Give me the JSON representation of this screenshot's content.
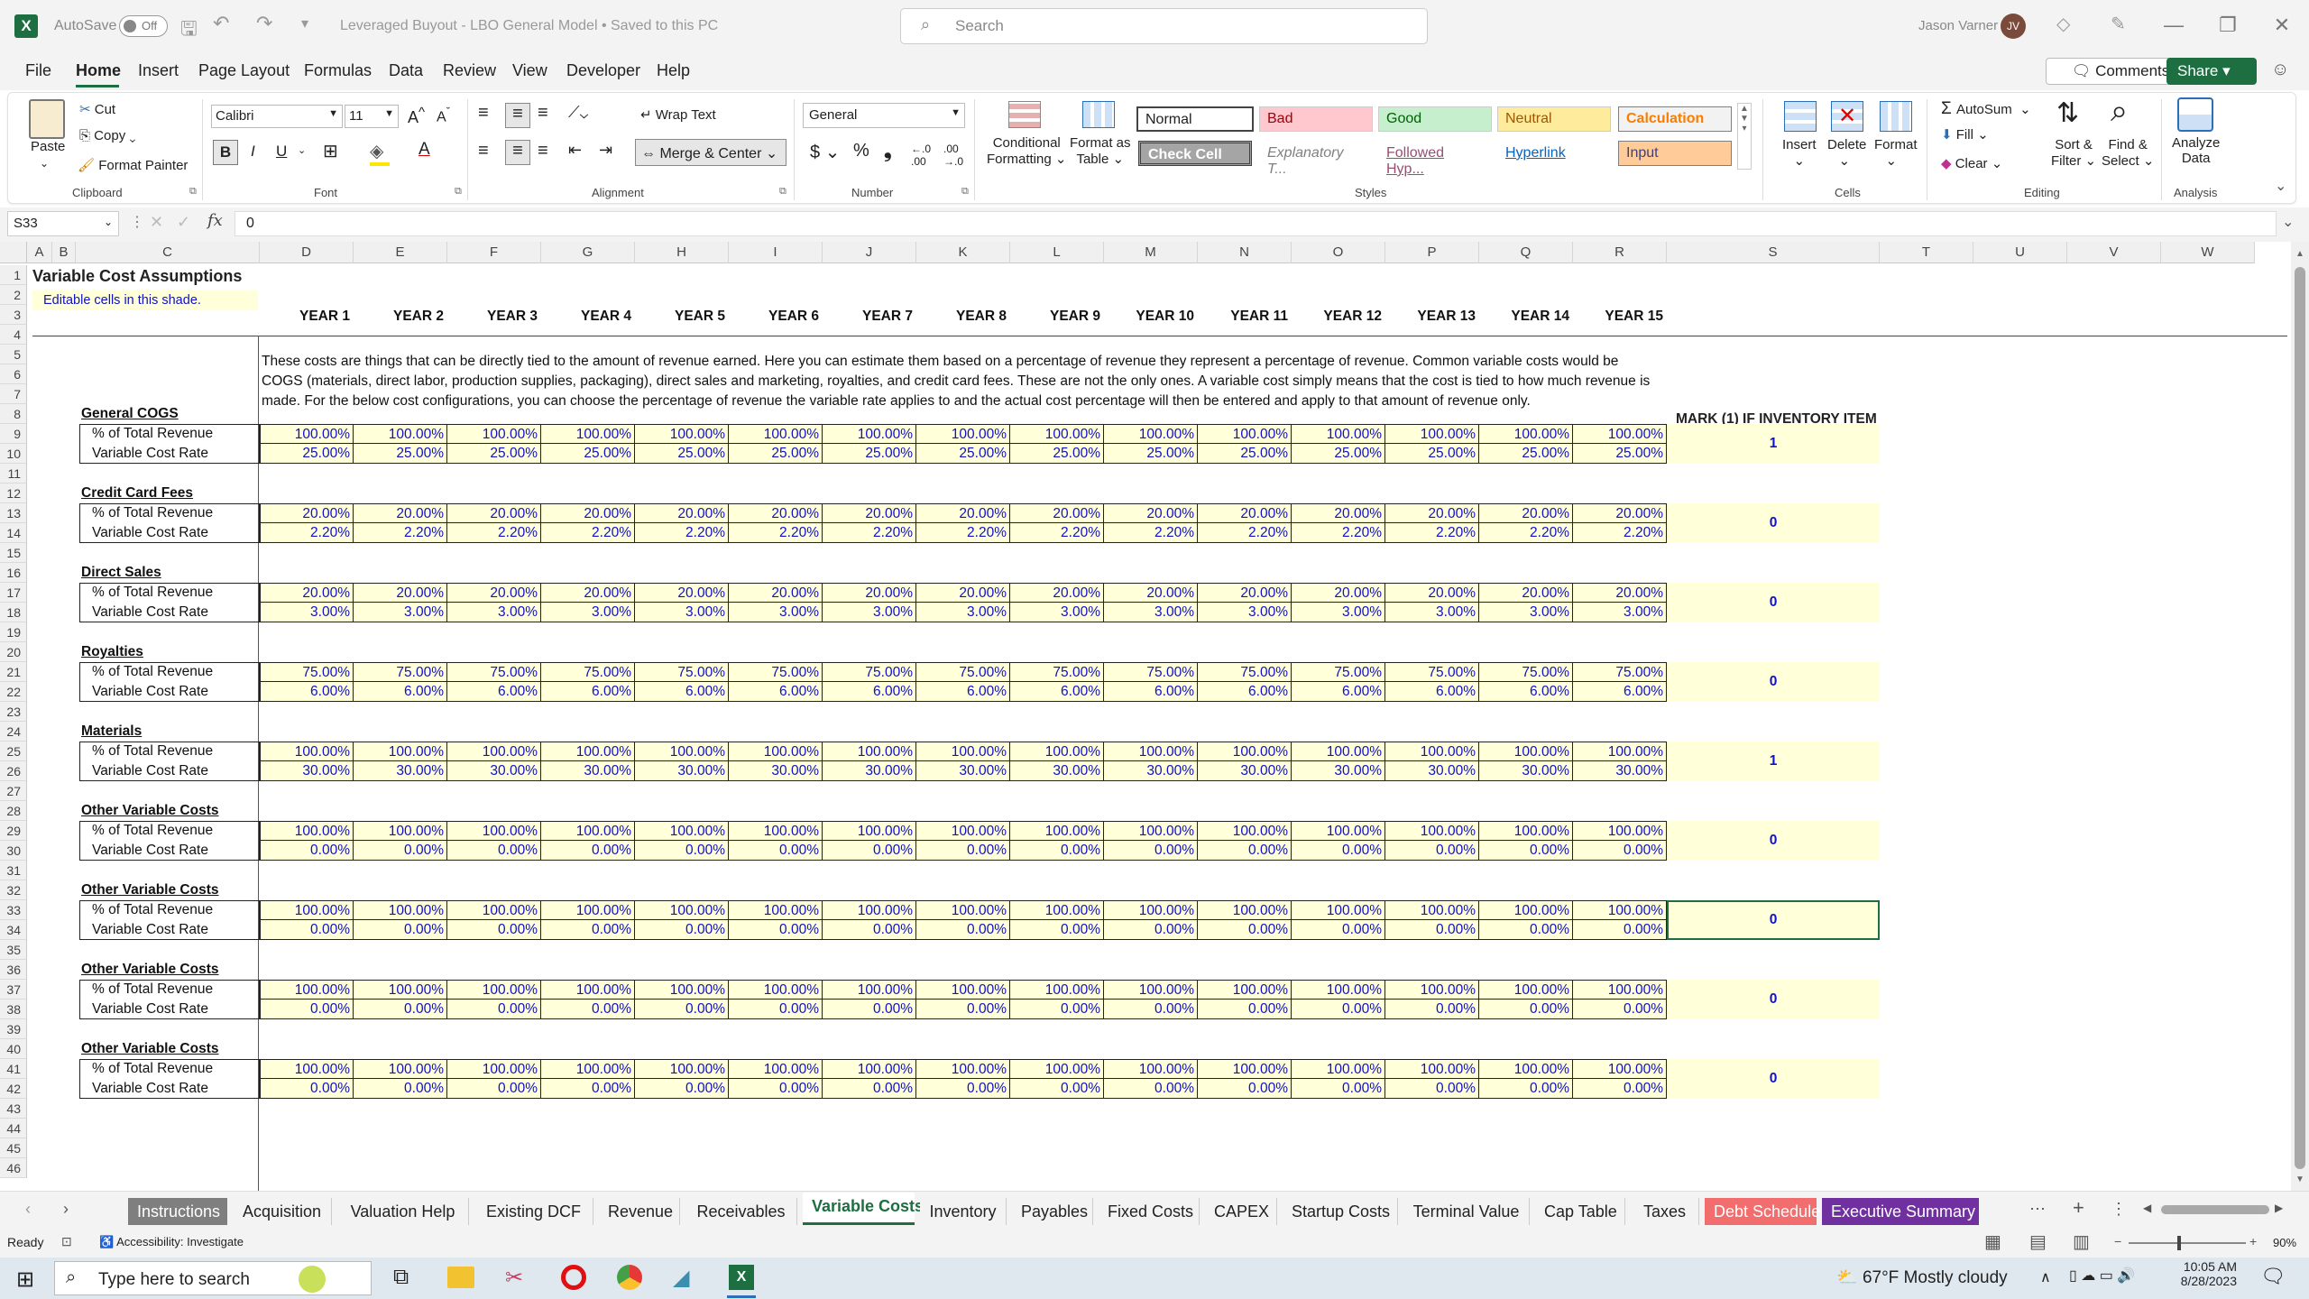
{
  "titlebar": {
    "autosave": "AutoSave",
    "autosave_state": "Off",
    "doc_title": "Leveraged Buyout - LBO General Model • Saved to this PC",
    "search_placeholder": "Search",
    "user_name": "Jason Varner",
    "user_initials": "JV"
  },
  "menu": [
    "File",
    "Home",
    "Insert",
    "Page Layout",
    "Formulas",
    "Data",
    "Review",
    "View",
    "Developer",
    "Help"
  ],
  "menu_right": {
    "comments": "Comments",
    "share": "Share"
  },
  "ribbon": {
    "clipboard": {
      "paste": "Paste",
      "cut": "Cut",
      "copy": "Copy",
      "format_painter": "Format Painter",
      "group": "Clipboard"
    },
    "font": {
      "name": "Calibri",
      "size": "11",
      "group": "Font"
    },
    "alignment": {
      "wrap": "Wrap Text",
      "merge": "Merge & Center",
      "group": "Alignment"
    },
    "number": {
      "format": "General",
      "group": "Number"
    },
    "styles": {
      "conditional": "Conditional",
      "formatting": "Formatting",
      "format_as": "Format as",
      "table": "Table",
      "normal": "Normal",
      "bad": "Bad",
      "good": "Good",
      "neutral": "Neutral",
      "calculation": "Calculation",
      "check_cell": "Check Cell",
      "explanatory": "Explanatory T...",
      "followed": "Followed Hyp...",
      "hyperlink": "Hyperlink",
      "input": "Input",
      "group": "Styles"
    },
    "cells": {
      "insert": "Insert",
      "delete": "Delete",
      "format": "Format",
      "group": "Cells"
    },
    "editing": {
      "autosum": "AutoSum",
      "fill": "Fill",
      "clear": "Clear",
      "sort": "Sort &",
      "filter": "Filter",
      "find": "Find &",
      "select": "Select",
      "group": "Editing"
    },
    "analysis": {
      "analyze": "Analyze",
      "data": "Data",
      "group": "Analysis"
    }
  },
  "formula_bar": {
    "name_box": "S33",
    "fx": "fx",
    "value": "0"
  },
  "columns": [
    "A",
    "B",
    "C",
    "D",
    "E",
    "F",
    "G",
    "H",
    "I",
    "J",
    "K",
    "L",
    "M",
    "N",
    "O",
    "P",
    "Q",
    "R",
    "S",
    "T",
    "U",
    "V",
    "W"
  ],
  "sheet": {
    "title": "Variable Cost Assumptions",
    "subtitle": "Editable cells in this shade.",
    "years": [
      "YEAR 1",
      "YEAR 2",
      "YEAR 3",
      "YEAR 4",
      "YEAR 5",
      "YEAR 6",
      "YEAR 7",
      "YEAR 8",
      "YEAR 9",
      "YEAR 10",
      "YEAR 11",
      "YEAR 12",
      "YEAR 13",
      "YEAR 14",
      "YEAR 15"
    ],
    "description": [
      "These costs are things that can be directly tied to the amount of revenue earned. Here you can estimate them based on a percentage of revenue they represent a percentage of revenue. Common variable costs would be",
      "COGS (materials, direct labor, production supplies, packaging), direct sales and marketing, royalties, and credit card fees. These are not the only ones. A variable cost simply means that the cost is tied to how much revenue is",
      "made. For the below cost configurations, you can choose the percentage of revenue the variable rate applies to and the actual cost percentage will then be entered and apply to that amount of revenue only."
    ],
    "inventory_header": "MARK (1) IF INVENTORY ITEM",
    "row_label_pct": "% of Total Revenue",
    "row_label_rate": "Variable Cost Rate",
    "blocks": [
      {
        "name": "General COGS",
        "pct": "100.00%",
        "rate": "25.00%",
        "mark": "1"
      },
      {
        "name": "Credit Card Fees",
        "pct": "20.00%",
        "rate": "2.20%",
        "mark": "0"
      },
      {
        "name": "Direct Sales",
        "pct": "20.00%",
        "rate": "3.00%",
        "mark": "0"
      },
      {
        "name": "Royalties",
        "pct": "75.00%",
        "rate": "6.00%",
        "mark": "0"
      },
      {
        "name": "Materials",
        "pct": "100.00%",
        "rate": "30.00%",
        "mark": "1"
      },
      {
        "name": "Other Variable Costs",
        "pct": "100.00%",
        "rate": "0.00%",
        "mark": "0"
      },
      {
        "name": "Other Variable Costs",
        "pct": "100.00%",
        "rate": "0.00%",
        "mark": "0"
      },
      {
        "name": "Other Variable Costs",
        "pct": "100.00%",
        "rate": "0.00%",
        "mark": "0"
      },
      {
        "name": "Other Variable Costs",
        "pct": "100.00%",
        "rate": "0.00%",
        "mark": "0"
      }
    ]
  },
  "tabs": [
    "Instructions",
    "Acquisition",
    "Valuation Help",
    "Existing DCF",
    "Revenue",
    "Receivables",
    "Variable Costs",
    "Inventory",
    "Payables",
    "Fixed Costs",
    "CAPEX",
    "Startup Costs",
    "Terminal Value",
    "Cap Table",
    "Taxes",
    "Debt Schedule",
    "Executive Summary"
  ],
  "tab_colors": {
    "Instructions": "#7f7f7f",
    "Debt Schedule": "#f26d6d",
    "Executive Summary": "#7030a0"
  },
  "active_tab": "Variable Costs",
  "status": {
    "ready": "Ready",
    "accessibility": "Accessibility: Investigate",
    "zoom": "90%"
  },
  "taskbar": {
    "search": "Type here to search",
    "weather": "67°F  Mostly cloudy",
    "time": "10:05 AM",
    "date": "8/28/2023"
  }
}
